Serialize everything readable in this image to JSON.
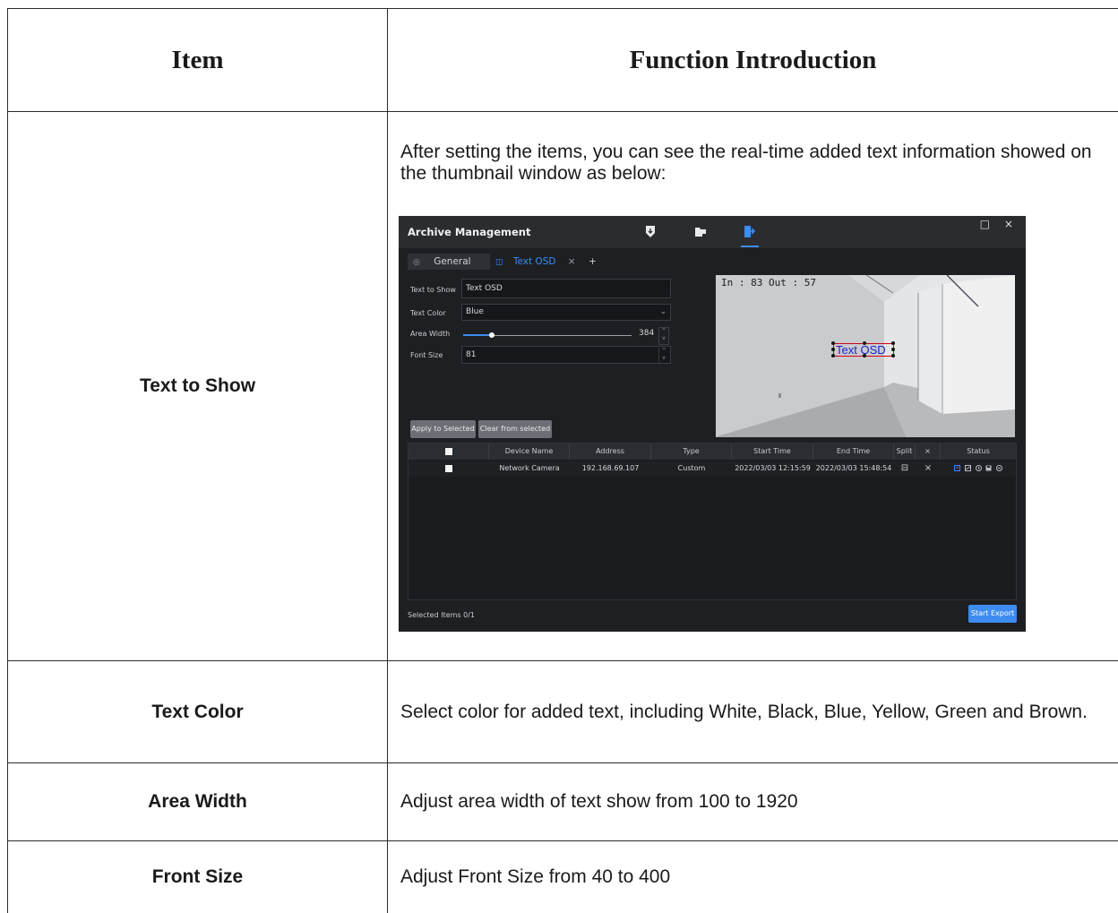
{
  "table": {
    "headers": {
      "item": "Item",
      "function": "Function Introduction"
    },
    "rows": [
      {
        "item": "Text to Show",
        "description": "After setting the items, you can see the real-time added text information showed on the thumbnail window as below:"
      },
      {
        "item": "Text Color",
        "description": "Select color for added text, including White, Black, Blue, Yellow, Green and Brown."
      },
      {
        "item": "Area Width",
        "description": "Adjust area width of text show from 100 to 1920"
      },
      {
        "item": "Front Size",
        "description": "Adjust Front Size from 40 to 400"
      }
    ]
  },
  "screenshot": {
    "title": "Archive Management",
    "window_buttons": "□ ×",
    "toolbar_icons": [
      "shield-download-icon",
      "folder-icon",
      "export-icon"
    ],
    "tabs": [
      {
        "icon": "◎",
        "label": "General"
      },
      {
        "icon": "◫",
        "label": "Text OSD",
        "close": "×"
      }
    ],
    "add_tab": "+",
    "form": {
      "text_to_show": {
        "label": "Text to Show",
        "value": "Text OSD"
      },
      "text_color": {
        "label": "Text Color",
        "value": "Blue"
      },
      "area_width": {
        "label": "Area Width",
        "value": "384",
        "slider_fraction": 0.17
      },
      "font_size": {
        "label": "Font Size",
        "value": "81"
      }
    },
    "buttons": {
      "apply": "Apply to Selected",
      "clear": "Clear from selected"
    },
    "preview": {
      "overlay_text": "Text OSD",
      "timestamp": "In : 83   Out : 57"
    },
    "device_table": {
      "columns": [
        "",
        "Device Name",
        "Address",
        "Type",
        "Start Time",
        "End Time",
        "Split",
        "×",
        "Status"
      ],
      "rows": [
        {
          "device_name": "Network Camera",
          "address": "192.168.69.107",
          "type": "Custom",
          "start_time": "2022/03/03 12:15:59",
          "end_time": "2022/03/03 15:48:54",
          "split": "⊟",
          "remove": "×"
        }
      ]
    },
    "footer": {
      "selected": "Selected Items  0/1",
      "start_export": "Start Export"
    },
    "colors": {
      "accent": "#3d8cf0",
      "background": "#1d1f22",
      "osd_text": "#1a22d6",
      "osd_box": "#d0021b"
    }
  }
}
